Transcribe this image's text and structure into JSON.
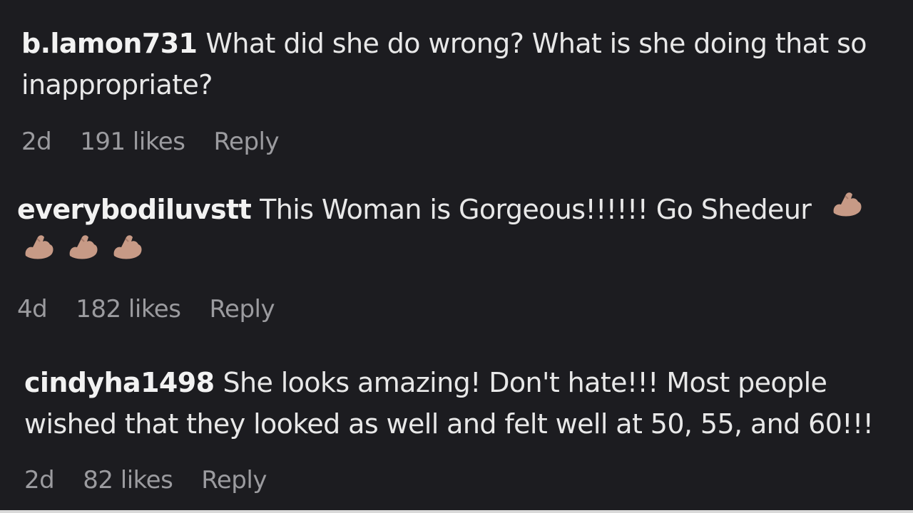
{
  "comments": [
    {
      "username": "b.lamon731",
      "text": "What did she do wrong? What is she doing that so inappropriate?",
      "age": "2d",
      "likes": "191 likes",
      "reply": "Reply"
    },
    {
      "username": "everybodiluvstt",
      "text": "This Woman is Gorgeous!!!!!! Go Shedeur",
      "emojis": [
        "flexed-biceps-icon",
        "flexed-biceps-icon",
        "flexed-biceps-icon",
        "flexed-biceps-icon"
      ],
      "age": "4d",
      "likes": "182 likes",
      "reply": "Reply"
    },
    {
      "username": "cindyha1498",
      "text": "She looks amazing! Don't hate!!! Most people wished that they looked as well and felt well at 50, 55, and 60!!!",
      "age": "2d",
      "likes": "82 likes",
      "reply": "Reply"
    }
  ],
  "colors": {
    "background": "#1c1c20",
    "text": "#ececec",
    "meta": "#9b9b9f",
    "emoji_skin": "#c79a86"
  }
}
